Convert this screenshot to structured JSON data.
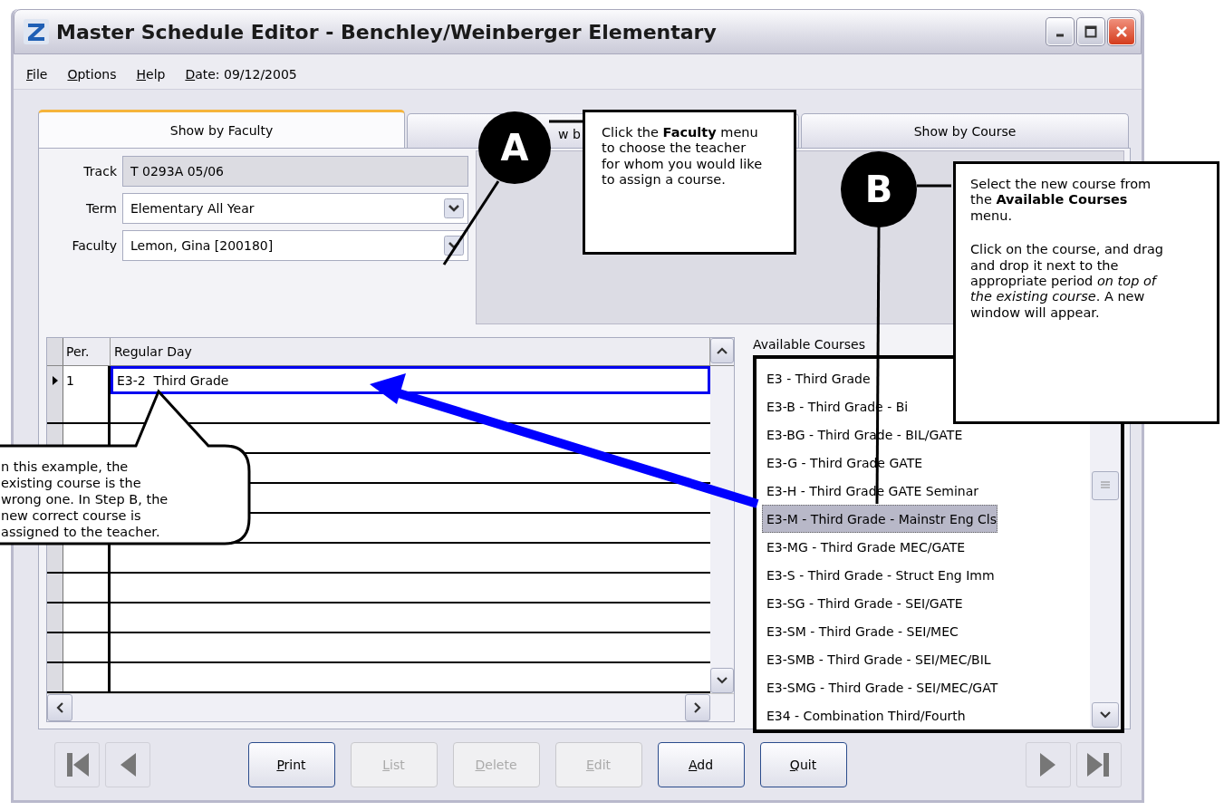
{
  "window": {
    "title": "Master Schedule Editor - Benchley/Weinberger Elementary"
  },
  "menu": [
    "File",
    "Options",
    "Help"
  ],
  "date": "Date: 09/12/2005",
  "tabs": [
    {
      "label": "Show by Faculty",
      "selected": true
    },
    {
      "label": "w b",
      "selected": false
    },
    {
      "label": "Show by Course",
      "selected": false
    }
  ],
  "fields": [
    {
      "label": "Track",
      "value": "T 0293A 05/06",
      "kind": "readonly"
    },
    {
      "label": "Term",
      "value": "Elementary All Year",
      "kind": "dropdown"
    },
    {
      "label": "Faculty",
      "value": "Lemon, Gina [200180]",
      "kind": "dropdown"
    }
  ],
  "schedule": {
    "columns": [
      "Per.",
      "Regular Day"
    ],
    "rows": [
      {
        "period": "1",
        "course": "E3-2  Third Grade",
        "selected": true
      }
    ]
  },
  "available_courses": {
    "label": "Available Courses",
    "items": [
      {
        "label": "E3 - Third Grade",
        "selected": false
      },
      {
        "label": "E3-B - Third Grade - Bi",
        "selected": false
      },
      {
        "label": "E3-BG - Third Grade - BIL/GATE",
        "selected": false
      },
      {
        "label": "E3-G - Third Grade GATE",
        "selected": false
      },
      {
        "label": "E3-H - Third Grade GATE Seminar",
        "selected": false
      },
      {
        "label": "E3-M - Third Grade - Mainstr Eng Cls",
        "selected": true
      },
      {
        "label": "E3-MG - Third Grade MEC/GATE",
        "selected": false
      },
      {
        "label": "E3-S - Third Grade - Struct Eng Imm",
        "selected": false
      },
      {
        "label": "E3-SG - Third Grade - SEI/GATE",
        "selected": false
      },
      {
        "label": "E3-SM - Third Grade - SEI/MEC",
        "selected": false
      },
      {
        "label": "E3-SMB - Third Grade - SEI/MEC/BIL",
        "selected": false
      },
      {
        "label": "E3-SMG - Third Grade - SEI/MEC/GAT",
        "selected": false
      },
      {
        "label": "E34 - Combination Third/Fourth",
        "selected": false
      }
    ]
  },
  "buttons": [
    {
      "label": "Print",
      "disabled": false
    },
    {
      "label": "List",
      "disabled": true
    },
    {
      "label": "Delete",
      "disabled": true
    },
    {
      "label": "Edit",
      "disabled": true
    },
    {
      "label": "Add",
      "disabled": false
    },
    {
      "label": "Quit",
      "disabled": false
    }
  ],
  "callouts": [
    {
      "marker": "A",
      "paragraphs": [
        "Click the **Faculty** menu to choose the teacher for whom you would like to assign a course."
      ]
    },
    {
      "marker": "B",
      "paragraphs": [
        "Select the new course from the **Available Courses** menu.",
        "Click on the course, and drag and drop it next to the appropriate period *on top of the existing course*. A new window will appear."
      ]
    }
  ],
  "note_lines": [
    "n this example, the",
    "existing course is the",
    "wrong one. In Step B, the",
    "new correct course is",
    "assigned to the teacher."
  ]
}
